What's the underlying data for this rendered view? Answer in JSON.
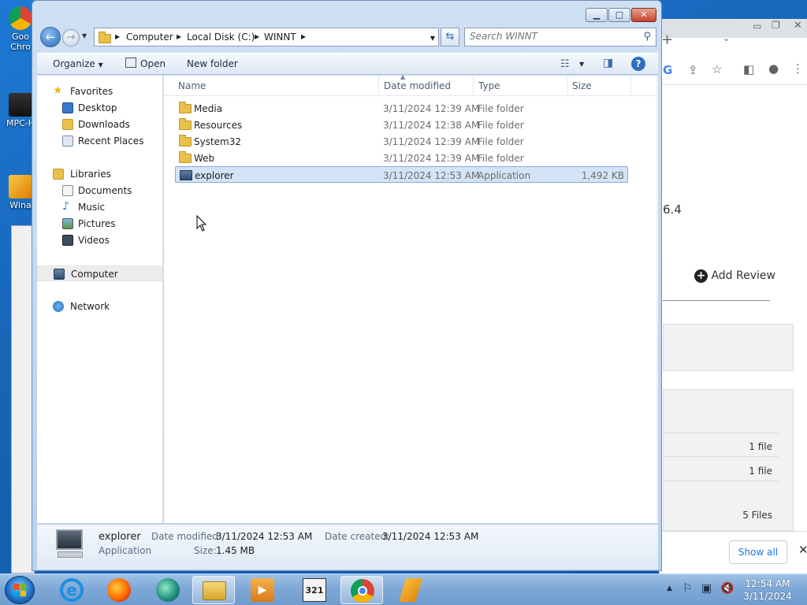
{
  "desktop": {
    "icons": [
      {
        "label": "Goo Chro",
        "icon": "chrome-icon"
      },
      {
        "label": "MPC-H",
        "icon": "mpc-hc-icon"
      },
      {
        "label": "Wina",
        "icon": "winamp-icon"
      }
    ]
  },
  "browser": {
    "partial_version": "6.4",
    "add_review": "Add Review",
    "file_counts": [
      "1 file",
      "1 file",
      "5 Files"
    ],
    "show_all": "Show all"
  },
  "explorer": {
    "breadcrumb": [
      "Computer",
      "Local Disk (C:)",
      "WINNT"
    ],
    "search_placeholder": "Search WINNT",
    "toolbar": {
      "organize": "Organize",
      "open": "Open",
      "new_folder": "New folder"
    },
    "nav": {
      "favorites": "Favorites",
      "desktop": "Desktop",
      "downloads": "Downloads",
      "recent_places": "Recent Places",
      "libraries": "Libraries",
      "documents": "Documents",
      "music": "Music",
      "pictures": "Pictures",
      "videos": "Videos",
      "computer": "Computer",
      "network": "Network"
    },
    "columns": {
      "name": "Name",
      "date_modified": "Date modified",
      "type": "Type",
      "size": "Size"
    },
    "files": [
      {
        "name": "Media",
        "date": "3/11/2024 12:39 AM",
        "type": "File folder",
        "size": "",
        "kind": "folder"
      },
      {
        "name": "Resources",
        "date": "3/11/2024 12:38 AM",
        "type": "File folder",
        "size": "",
        "kind": "folder"
      },
      {
        "name": "System32",
        "date": "3/11/2024 12:39 AM",
        "type": "File folder",
        "size": "",
        "kind": "folder"
      },
      {
        "name": "Web",
        "date": "3/11/2024 12:39 AM",
        "type": "File folder",
        "size": "",
        "kind": "folder"
      },
      {
        "name": "explorer",
        "date": "3/11/2024 12:53 AM",
        "type": "Application",
        "size": "1,492 KB",
        "kind": "app"
      }
    ],
    "details": {
      "name": "explorer",
      "type": "Application",
      "date_modified_label": "Date modified:",
      "date_modified": "3/11/2024 12:53 AM",
      "date_created_label": "Date created:",
      "date_created": "3/11/2024 12:53 AM",
      "size_label": "Size:",
      "size": "1.45 MB"
    }
  },
  "taskbar": {
    "time": "12:54 AM",
    "date": "3/11/2024",
    "apps": [
      "internet-explorer-icon",
      "firefox-icon",
      "chat-icon",
      "file-explorer-icon",
      "media-player-icon",
      "mpc-hc-icon",
      "chrome-icon",
      "winamp-icon"
    ]
  },
  "colors": {
    "selection_bg": "#d4e3f5",
    "selection_border": "#84acdd",
    "desktop_bg": "#1766b8",
    "folder": "#e9c14a"
  }
}
